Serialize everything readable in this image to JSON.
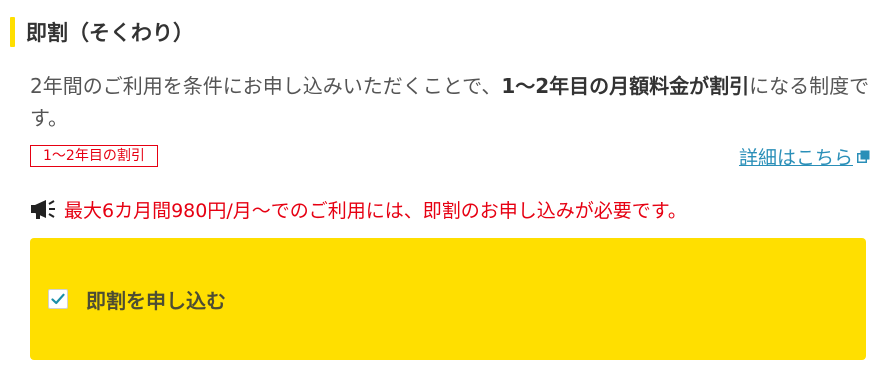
{
  "section": {
    "title": "即割（そくわり）"
  },
  "description": {
    "part1": "2年間のご利用を条件にお申し込みいただくことで、",
    "emphasis": "1〜2年目の月額料金が割引",
    "part2": "になる制度です。"
  },
  "tag": {
    "label": "1〜2年目の割引"
  },
  "details_link": {
    "label": "詳細はこちら",
    "icon": "external-link-icon"
  },
  "notice": {
    "icon": "megaphone-icon",
    "text": "最大6カ月間980円/月〜でのご利用には、即割のお申し込みが必要です。"
  },
  "apply": {
    "label": "即割を申し込む",
    "checked": true
  },
  "colors": {
    "accent_yellow": "#ffdf00",
    "alert_red": "#e60012",
    "link_blue": "#2a8fb8",
    "check_teal": "#1a8fa8"
  }
}
